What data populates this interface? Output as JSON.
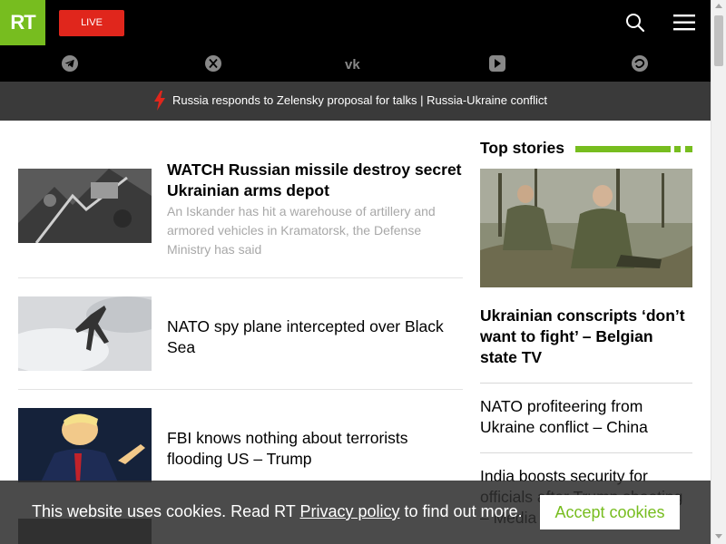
{
  "header": {
    "logo_text": "RT",
    "live_label": "LIVE",
    "icons": [
      "search-icon",
      "menu-icon"
    ],
    "social_icons": [
      "telegram-icon",
      "x-icon",
      "vk-icon",
      "rumble-icon",
      "odysee-icon"
    ]
  },
  "breaking": {
    "text": "Russia responds to Zelensky proposal for talks | Russia-Ukraine conflict"
  },
  "articles": [
    {
      "title": "WATCH Russian missile destroy secret Ukrainian arms depot",
      "summary": "An Iskander has hit a warehouse of artillery and armored vehicles in Kramatorsk, the Defense Ministry has said"
    },
    {
      "title": "NATO spy plane intercepted over Black Sea"
    },
    {
      "title": "FBI knows nothing about terrorists flooding US – Trump"
    }
  ],
  "top_stories": {
    "heading": "Top stories",
    "featured_title": "Ukrainian conscripts ‘don’t want to fight’ – Belgian state TV",
    "items": [
      "NATO profiteering from Ukraine conflict – China",
      "India boosts security for officials after Trump shooting – Media"
    ]
  },
  "cookie": {
    "text_before": "This website uses cookies. Read RT ",
    "link_text": "Privacy policy",
    "text_after": " to find out more.",
    "accept_label": "Accept cookies"
  },
  "colors": {
    "brand_green": "#77bd1f",
    "live_red": "#e0261c",
    "breaking_bg": "#3a3a3a",
    "bolt_red": "#e0261c"
  }
}
